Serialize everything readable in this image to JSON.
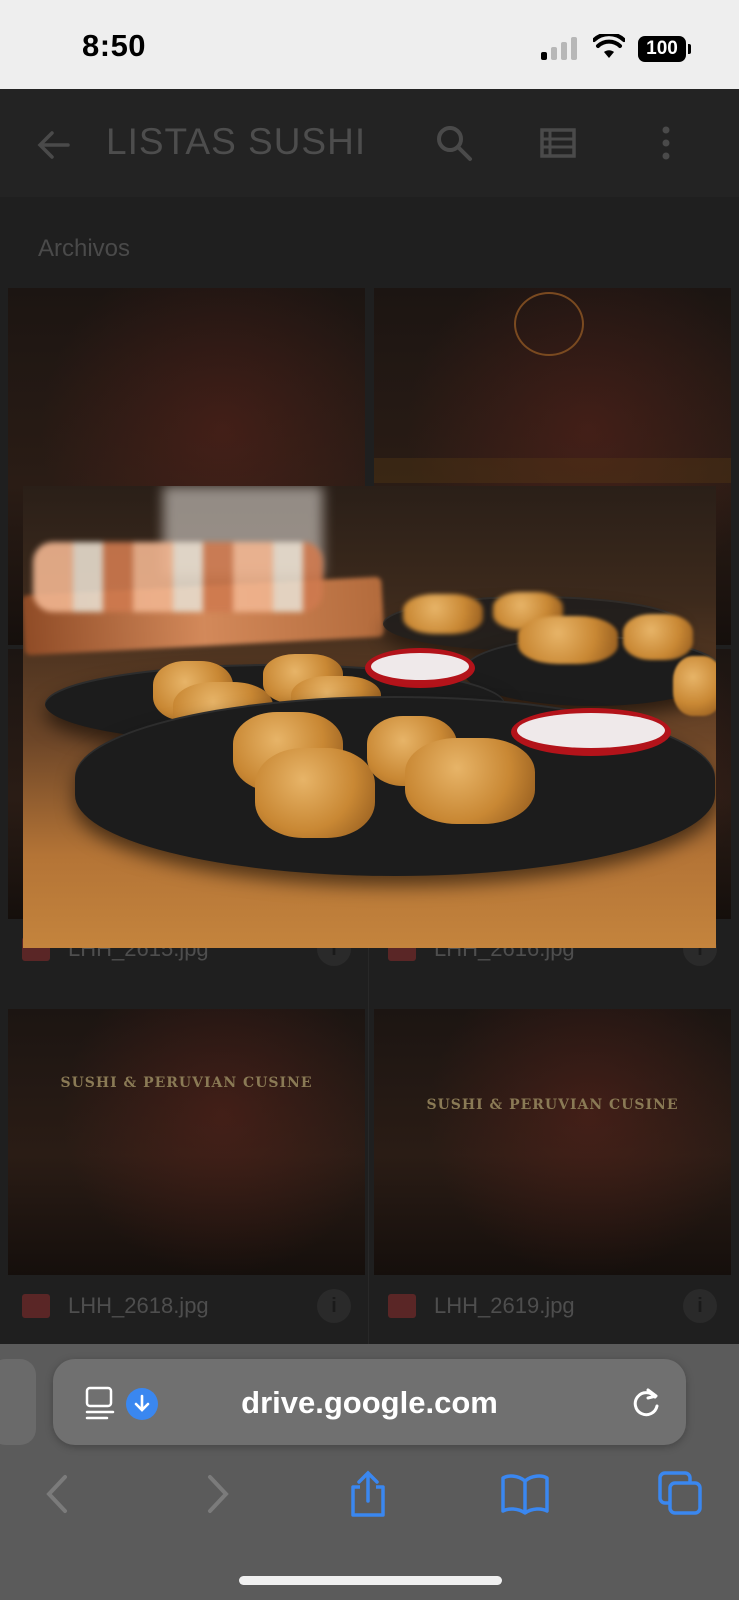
{
  "status_bar": {
    "time": "8:50",
    "battery": "100"
  },
  "header": {
    "title": "LISTAS SUSHI"
  },
  "section": {
    "label": "Archivos"
  },
  "files": [
    {
      "name": "LHH_2615.jpg"
    },
    {
      "name": "LHH_2616.jpg"
    },
    {
      "name": "LHH_2618.jpg"
    },
    {
      "name": "LHH_2619.jpg"
    }
  ],
  "thumb_text": {
    "sign": "SUSHI & PERUVIAN CUSINE"
  },
  "browser": {
    "url": "drive.google.com"
  },
  "colors": {
    "accent": "#3a87f0"
  }
}
